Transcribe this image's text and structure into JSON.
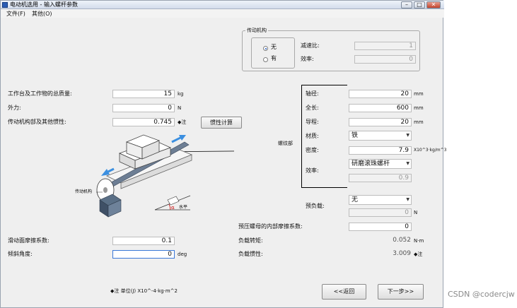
{
  "window": {
    "title": "电动机选用 - 输入螺杆参数",
    "buttons": {
      "minimize": "–",
      "maximize": "□",
      "close": "✕"
    }
  },
  "menu": [
    {
      "label": "文件(F)"
    },
    {
      "label": "其他(O)"
    }
  ],
  "transmission": {
    "title": "传动机构",
    "none_label": "无",
    "yes_label": "有",
    "selected": "none",
    "ratio_label": "减速比:",
    "ratio_value": "1",
    "efficiency_label": "效率:",
    "efficiency_value": "0"
  },
  "left": {
    "total_mass": {
      "label": "工作台及工作物的总质量:",
      "value": "15",
      "unit": "kg"
    },
    "external_force": {
      "label": "外力:",
      "value": "0",
      "unit": "N"
    },
    "inertia": {
      "label": "传动机构部及其他惯性:",
      "value": "0.745",
      "unit": "◆注"
    },
    "inertia_calc_button": "惯性计算",
    "friction": {
      "label": "滑动面摩擦系数:",
      "value": "0.1"
    },
    "angle": {
      "label": "倾斜角度:",
      "value": "0",
      "unit": "deg"
    }
  },
  "diagram": {
    "transmission_label": "传动机构",
    "angle_label": "α",
    "horizontal_label": "水平",
    "screw_part_label": "螺纹部"
  },
  "screw": {
    "diameter": {
      "label": "轴径:",
      "value": "20",
      "unit": "mm"
    },
    "length": {
      "label": "全长:",
      "value": "600",
      "unit": "mm"
    },
    "lead": {
      "label": "导程:",
      "value": "20",
      "unit": "mm"
    },
    "material": {
      "label": "材质:",
      "value": "铁"
    },
    "density": {
      "label": "密度:",
      "value": "7.9",
      "unit": "X10^3·kg/m^3"
    },
    "efficiency": {
      "label": "效率:",
      "value": "研磨滚珠螺杆",
      "number": "0.9"
    }
  },
  "preload": {
    "label": "预负载:",
    "value": "无",
    "number": "0",
    "unit": "N",
    "internal_friction_label": "预压螺母的内部摩擦系数:",
    "internal_friction_value": "0"
  },
  "results": {
    "torque_label": "负载转矩:",
    "torque_value": "0.052",
    "torque_unit": "N·m",
    "inertia_label": "负载惯性:",
    "inertia_value": "3.009",
    "inertia_unit": "◆注"
  },
  "footer": {
    "note": "◆注  单位(J)  X10^-4·kg·m^2",
    "back_button": "<<返回",
    "next_button": "下一步>>"
  },
  "watermark": "CSDN @codercjw",
  "colors": {
    "arrow": "#3b8fe0",
    "angle": "#cc0000",
    "focus": "#3a78d8"
  }
}
